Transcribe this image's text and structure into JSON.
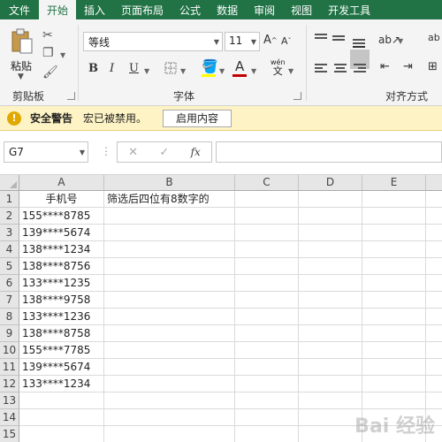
{
  "tabs": [
    "文件",
    "开始",
    "插入",
    "页面布局",
    "公式",
    "数据",
    "审阅",
    "视图",
    "开发工具"
  ],
  "ribbon": {
    "paste_label": "粘贴",
    "clipboard_label": "剪贴板",
    "font_label": "字体",
    "align_label": "对齐方式",
    "font_name": "等线",
    "font_size": "11",
    "grow_label": "A",
    "shrink_label": "A",
    "bold": "B",
    "italic": "I",
    "underline": "U",
    "phonetic": "wén",
    "phonetic_sub": "文",
    "font_color_label": "A",
    "wrap_label": "ab"
  },
  "security_bar": {
    "title": "安全警告",
    "message": "宏已被禁用。",
    "button": "启用内容"
  },
  "formula_bar": {
    "name_box": "G7",
    "fx": "fx",
    "content": ""
  },
  "columns": [
    "A",
    "B",
    "C",
    "D",
    "E"
  ],
  "rows": [
    "1",
    "2",
    "3",
    "4",
    "5",
    "6",
    "7",
    "8",
    "9",
    "10",
    "11",
    "12",
    "13",
    "14",
    "15"
  ],
  "cells": {
    "A": [
      "手机号",
      "155****8785",
      "139****5674",
      "138****1234",
      "138****8756",
      "133****1235",
      "138****9758",
      "133****1236",
      "138****8758",
      "155****7785",
      "139****5674",
      "133****1234",
      "",
      "",
      ""
    ],
    "B": [
      "筛选后四位有8数字的",
      "",
      "",
      "",
      "",
      "",
      "",
      "",
      "",
      "",
      "",
      "",
      "",
      "",
      ""
    ]
  },
  "colors": {
    "brand": "#217346",
    "warning_bg": "#fdf3c4",
    "font_color_bar": "#c00000",
    "fill_color_bar": "#ffff00"
  },
  "watermark": "Bai 经验"
}
